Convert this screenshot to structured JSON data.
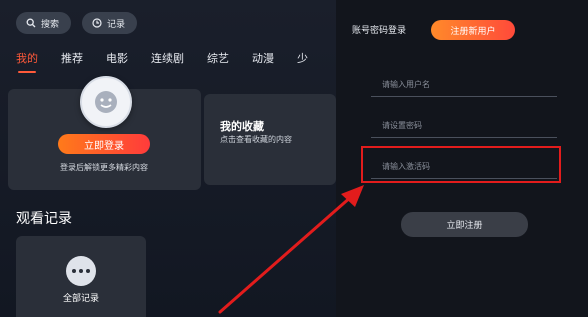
{
  "header": {
    "search_label": "搜索",
    "history_label": "记录"
  },
  "tabs": [
    "我的",
    "推荐",
    "电影",
    "连续剧",
    "综艺",
    "动漫",
    "少"
  ],
  "profile_card": {
    "login_button": "立即登录",
    "subtitle": "登录后解锁更多精彩内容"
  },
  "favorites_card": {
    "title": "我的收藏",
    "subtitle": "点击查看收藏的内容"
  },
  "history": {
    "title": "观看记录",
    "all_label": "全部记录"
  },
  "auth_panel": {
    "login_tab": "账号密码登录",
    "register_tab": "注册新用户",
    "username_placeholder": "请输入用户名",
    "password_placeholder": "请设置密码",
    "activation_placeholder": "请输入激活码",
    "register_button": "立即注册"
  },
  "colors": {
    "accent": "#ff5a3a",
    "highlight": "#e21c1c"
  }
}
